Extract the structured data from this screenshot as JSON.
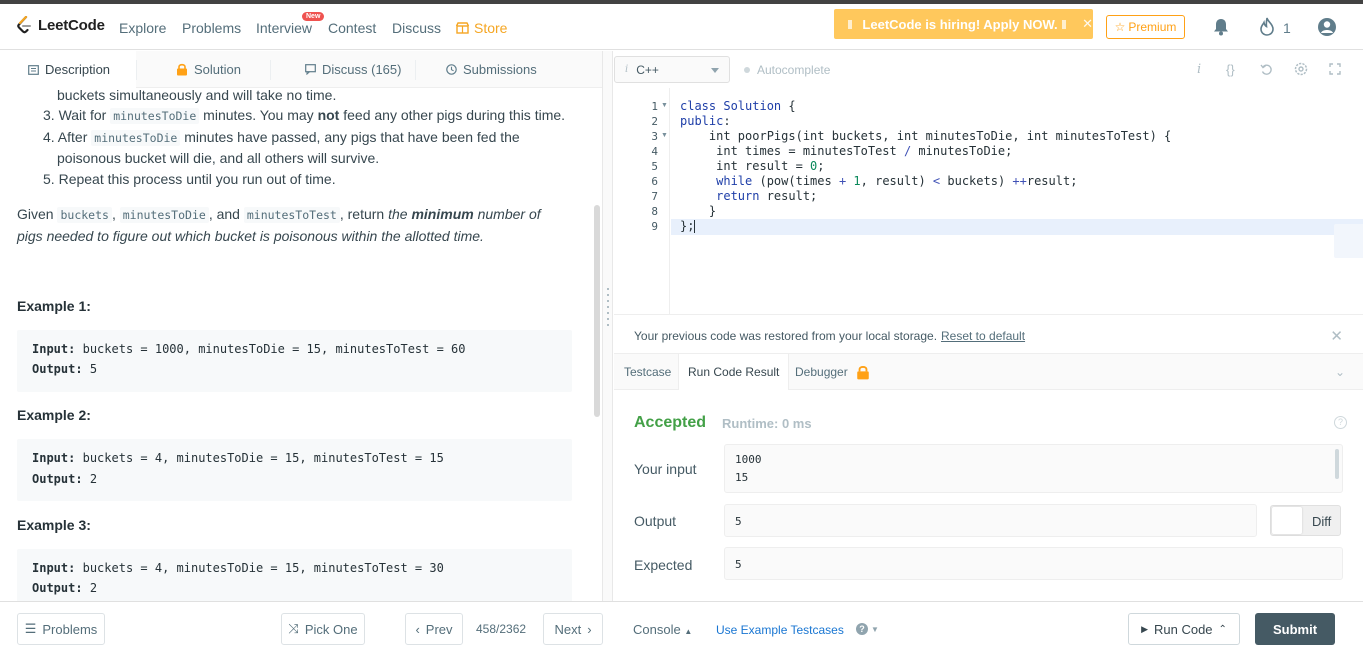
{
  "nav": {
    "brand": "LeetCode",
    "links": [
      "Explore",
      "Problems",
      "Interview",
      "Contest",
      "Discuss",
      "Store"
    ],
    "new_badge": "New",
    "hiring": "LeetCode is hiring! Apply NOW.",
    "premium": "Premium",
    "streak": "1",
    "colors": {
      "store": "#f5a623",
      "hiring_bg": "#ffc85c",
      "premium": "#ffa116"
    }
  },
  "tabs": {
    "description": "Description",
    "solution": "Solution",
    "discuss": "Discuss (165)",
    "submissions": "Submissions"
  },
  "problem": {
    "step_cont": "buckets simultaneously and will take no time.",
    "step3_a": "Wait for",
    "step3_code": "minutesToDie",
    "step3_b": "minutes. You may",
    "step3_bold": "not",
    "step3_c": "feed any other pigs during this time.",
    "step4_a": "After",
    "step4_code": "minutesToDie",
    "step4_b": "minutes have passed, any pigs that have been fed the",
    "step4_c": "poisonous bucket will die, and all others will survive.",
    "step5": "Repeat this process until you run out of time.",
    "given": "Given",
    "given_c1": "buckets",
    "given_c2": "minutesToDie",
    "given_and": ", and",
    "given_c3": "minutesToTest",
    "given_ret": ", return",
    "given_the": "the",
    "given_min": "minimum",
    "given_rest1": "number of",
    "given_rest2": "pigs needed to figure out which bucket is poisonous within the allotted time.",
    "examples": [
      {
        "title": "Example 1:",
        "input_label": "Input:",
        "input": "buckets = 1000, minutesToDie = 15, minutesToTest = 60",
        "output_label": "Output:",
        "output": "5"
      },
      {
        "title": "Example 2:",
        "input_label": "Input:",
        "input": "buckets = 4, minutesToDie = 15, minutesToTest = 15",
        "output_label": "Output:",
        "output": "2"
      },
      {
        "title": "Example 3:",
        "input_label": "Input:",
        "input": "buckets = 4, minutesToDie = 15, minutesToTest = 30",
        "output_label": "Output:",
        "output": "2"
      }
    ]
  },
  "editor": {
    "language": "C++",
    "autocomplete": "Autocomplete",
    "line_numbers": [
      "1",
      "2",
      "3",
      "4",
      "5",
      "6",
      "7",
      "8",
      "9"
    ]
  },
  "restore": {
    "text": "Your previous code was restored from your local storage.",
    "link": "Reset to default"
  },
  "result_tabs": {
    "testcase": "Testcase",
    "run_result": "Run Code Result",
    "debugger": "Debugger"
  },
  "result": {
    "status": "Accepted",
    "runtime": "Runtime: 0 ms",
    "your_input_label": "Your input",
    "your_input": [
      "1000",
      "15"
    ],
    "output_label": "Output",
    "output": "5",
    "expected_label": "Expected",
    "expected": "5",
    "diff": "Diff",
    "colors": {
      "accepted": "#43a047"
    }
  },
  "bottom": {
    "problems": "Problems",
    "pick_one": "Pick One",
    "prev": "Prev",
    "pager": "458/2362",
    "next": "Next",
    "console": "Console",
    "use_example": "Use Example Testcases",
    "run_code": "Run Code",
    "submit": "Submit"
  }
}
